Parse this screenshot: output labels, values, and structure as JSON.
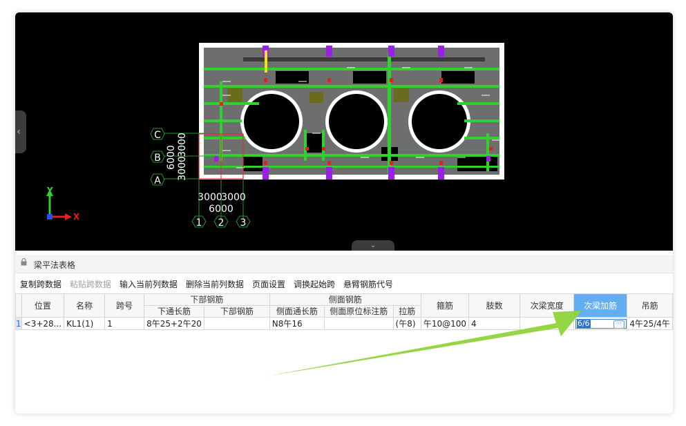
{
  "viewport": {
    "axis_labels": {
      "x": "X",
      "y": "Y"
    },
    "grid_rows": [
      {
        "label": "C"
      },
      {
        "label": "B"
      },
      {
        "label": "A"
      }
    ],
    "grid_cols": [
      {
        "label": "1"
      },
      {
        "label": "2"
      },
      {
        "label": "3"
      }
    ],
    "dim_left_top": "6000",
    "dim_left_bottom": "3000",
    "dim_left_mid": "3000",
    "dim_bottom_left": "3000",
    "dim_bottom_right": "3000",
    "dim_bottom_total": "6000",
    "colors": {
      "background": "#000000",
      "slab": "#6e6e6e",
      "bar": "#2fd12f",
      "column": "#9b1fe8",
      "grid": "#1f9a2a",
      "hatch": "#6b6b20"
    }
  },
  "panel": {
    "title": "梁平法表格"
  },
  "toolbar": {
    "copy_span": "复制跨数据",
    "paste_span": "粘贴跨数据",
    "input_col": "输入当前列数据",
    "delete_col": "删除当前列数据",
    "page_setup": "页面设置",
    "swap_start": "调换起始跨",
    "cantilever_code": "悬臂钢筋代号"
  },
  "table": {
    "headers": {
      "position": "位置",
      "name": "名称",
      "span": "跨号",
      "bottom_group": "下部钢筋",
      "bottom_through": "下通长筋",
      "bottom_bars": "下部钢筋",
      "side_group": "侧面钢筋",
      "side_through": "侧面通长筋",
      "side_original": "侧面原位标注筋",
      "tie": "拉筋",
      "stirrup": "箍筋",
      "legs": "肢数",
      "sub_beam_width": "次梁宽度",
      "sub_beam_rebar": "次梁加筋",
      "hanger": "吊筋"
    },
    "row": {
      "rowno": "1",
      "position": "<3+28...",
      "name": "KL1(1)",
      "span": "1",
      "bottom_through": "8午25+2午20",
      "bottom_bars": "",
      "side_through": "N8午16",
      "side_original": "",
      "tie": "(午8)",
      "stirrup": "午10@100",
      "legs": "4",
      "sub_beam_width": "",
      "sub_beam_rebar": "6/6",
      "hanger": "4午25/4午"
    }
  },
  "annotation": {
    "arrow_color": "#8fd43a"
  }
}
